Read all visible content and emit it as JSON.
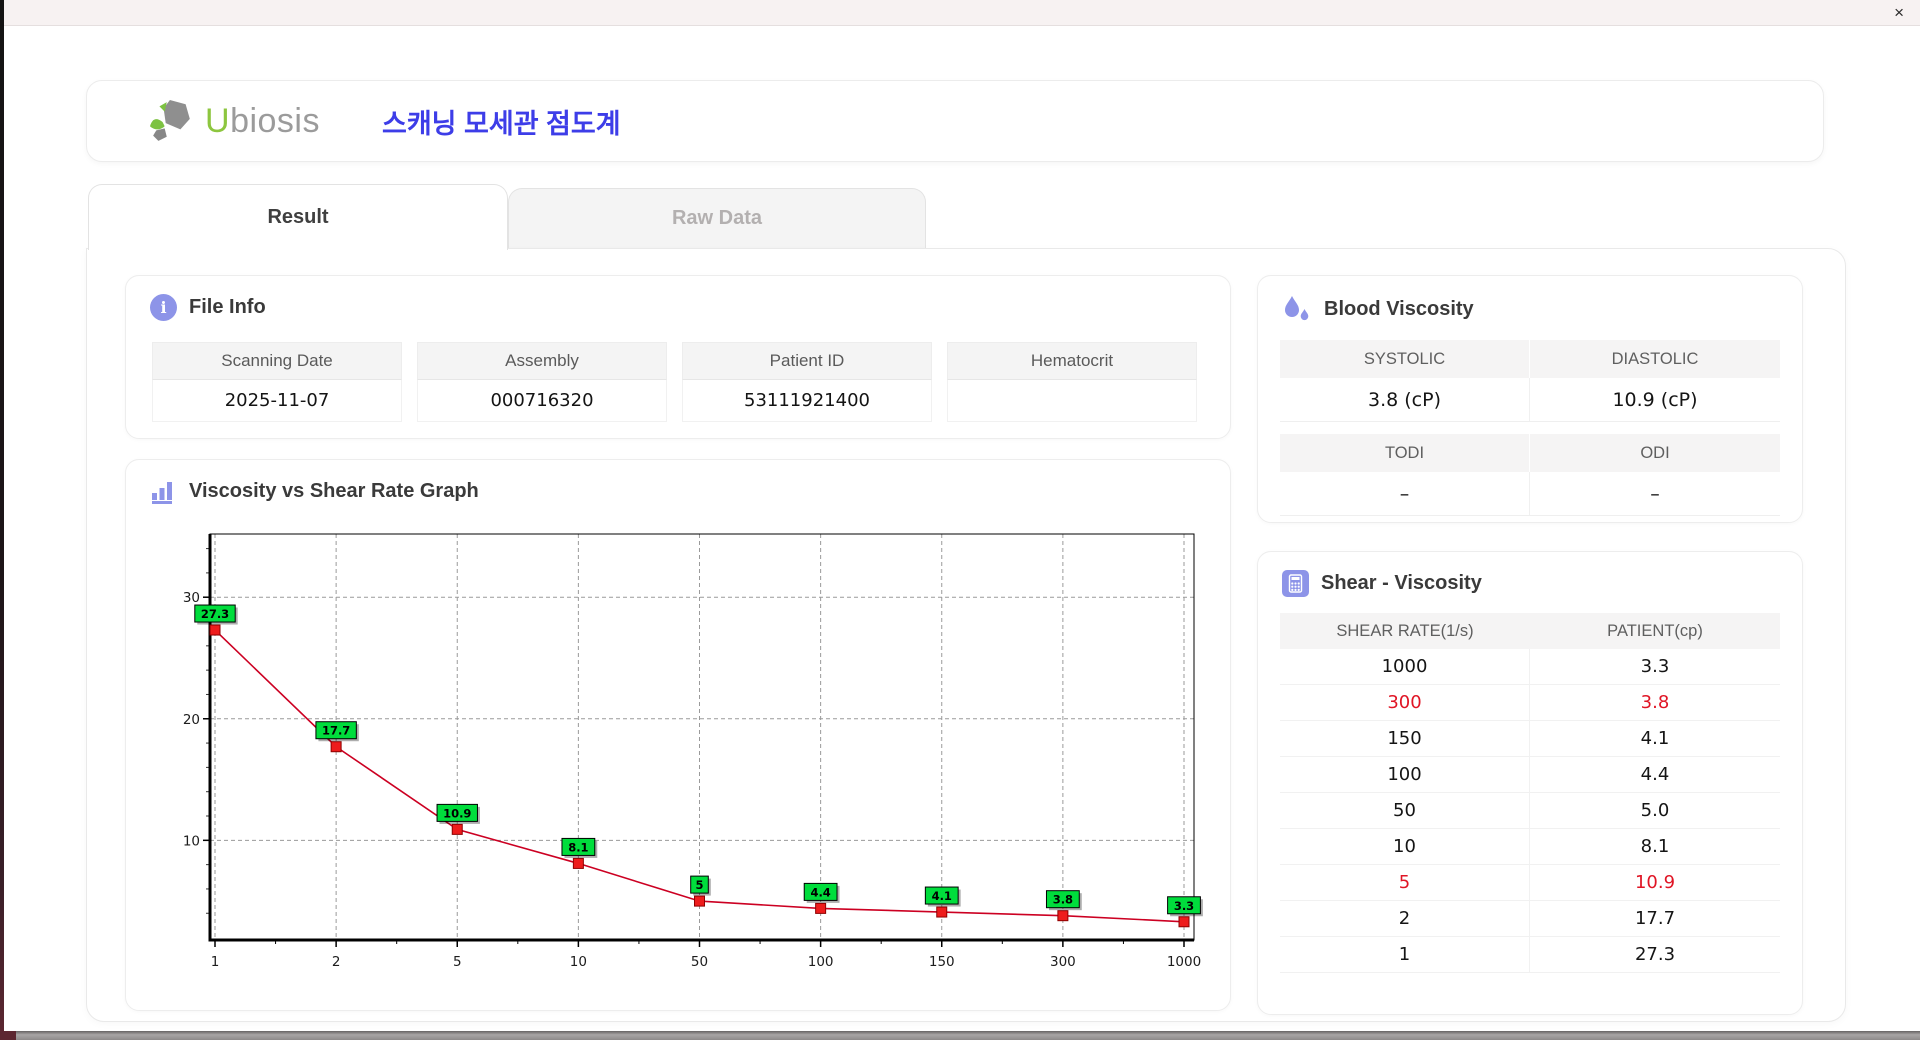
{
  "window": {
    "close_label": "×"
  },
  "header": {
    "logo_u": "U",
    "logo_rest": "biosis",
    "app_title": "스캐닝 모세관 점도계"
  },
  "tabs": {
    "result": "Result",
    "raw": "Raw Data"
  },
  "file_info": {
    "title": "File Info",
    "icon_glyph": "i",
    "fields": [
      {
        "label": "Scanning Date",
        "value": "2025-11-07"
      },
      {
        "label": "Assembly",
        "value": "000716320"
      },
      {
        "label": "Patient ID",
        "value": "53111921400"
      },
      {
        "label": "Hematocrit",
        "value": ""
      }
    ]
  },
  "blood_viscosity": {
    "title": "Blood Viscosity",
    "systolic_label": "SYSTOLIC",
    "systolic_value": "3.8 (cP)",
    "diastolic_label": "DIASTOLIC",
    "diastolic_value": "10.9 (cP)",
    "todi_label": "TODI",
    "todi_value": "–",
    "odi_label": "ODI",
    "odi_value": "–"
  },
  "shear_table": {
    "title": "Shear - Viscosity",
    "columns": [
      "SHEAR RATE(1/s)",
      "PATIENT(cp)"
    ],
    "rows": [
      {
        "shear": "1000",
        "patient": "3.3",
        "highlight": false
      },
      {
        "shear": "300",
        "patient": "3.8",
        "highlight": true
      },
      {
        "shear": "150",
        "patient": "4.1",
        "highlight": false
      },
      {
        "shear": "100",
        "patient": "4.4",
        "highlight": false
      },
      {
        "shear": "50",
        "patient": "5.0",
        "highlight": false
      },
      {
        "shear": "10",
        "patient": "8.1",
        "highlight": false
      },
      {
        "shear": "5",
        "patient": "10.9",
        "highlight": true
      },
      {
        "shear": "2",
        "patient": "17.7",
        "highlight": false
      },
      {
        "shear": "1",
        "patient": "27.3",
        "highlight": false
      }
    ]
  },
  "graph": {
    "title": "Viscosity vs Shear Rate Graph"
  },
  "chart_data": {
    "type": "line",
    "title": "Viscosity vs Shear Rate Graph",
    "xlabel": "",
    "ylabel": "",
    "x_scale": "category",
    "categories": [
      "1",
      "2",
      "5",
      "10",
      "50",
      "100",
      "150",
      "300",
      "1000"
    ],
    "values": [
      27.3,
      17.7,
      10.9,
      8.1,
      5.0,
      4.4,
      4.1,
      3.8,
      3.3
    ],
    "point_labels": [
      "27.3",
      "17.7",
      "10.9",
      "8.1",
      "5",
      "4.4",
      "4.1",
      "3.8",
      "3.3"
    ],
    "y_ticks": [
      10,
      20,
      30
    ],
    "ylim": [
      1.8,
      35.2
    ],
    "grid": "dashed",
    "line_color": "#cc0022",
    "marker_color": "#ee1c1c",
    "marker_stroke": "#8e0000",
    "label_bg": "#00dd3c",
    "grid_color": "#9a9a9a"
  },
  "colors": {
    "accent": "#8d94e8",
    "title_blue": "#3d3de8",
    "logo_green": "#8dc63f",
    "logo_gray": "#9b9b9b",
    "highlight_red": "#e01525"
  }
}
